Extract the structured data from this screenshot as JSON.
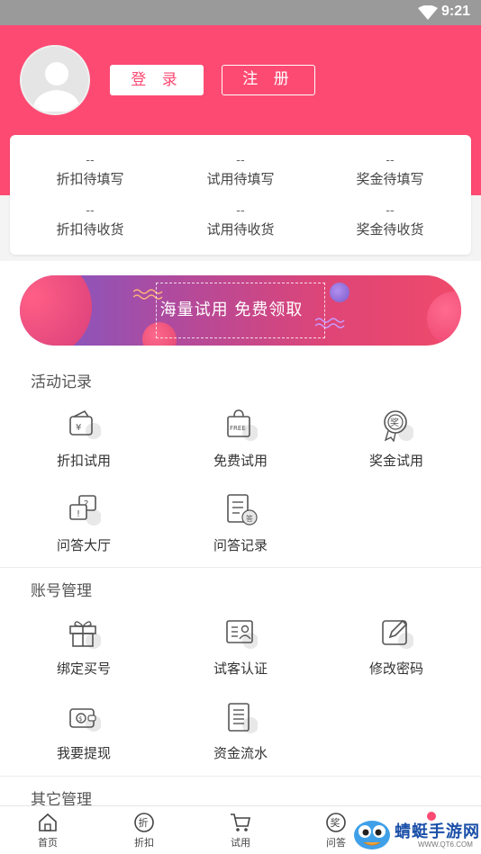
{
  "status_bar": {
    "time": "9:21"
  },
  "header": {
    "login_label": "登 录",
    "register_label": "注 册"
  },
  "stats": [
    {
      "value": "--",
      "label": "折扣待填写"
    },
    {
      "value": "--",
      "label": "试用待填写"
    },
    {
      "value": "--",
      "label": "奖金待填写"
    },
    {
      "value": "--",
      "label": "折扣待收货"
    },
    {
      "value": "--",
      "label": "试用待收货"
    },
    {
      "value": "--",
      "label": "奖金待收货"
    }
  ],
  "banner": {
    "text": "海量试用  免费领取"
  },
  "sections": {
    "activity": {
      "title": "活动记录",
      "items": [
        {
          "label": "折扣试用",
          "icon": "discount-wallet-icon"
        },
        {
          "label": "免费试用",
          "icon": "free-bag-icon"
        },
        {
          "label": "奖金试用",
          "icon": "prize-badge-icon"
        },
        {
          "label": "问答大厅",
          "icon": "qa-hall-icon"
        },
        {
          "label": "问答记录",
          "icon": "qa-record-icon"
        }
      ]
    },
    "account": {
      "title": "账号管理",
      "items": [
        {
          "label": "绑定买号",
          "icon": "gift-icon"
        },
        {
          "label": "试客认证",
          "icon": "id-card-icon"
        },
        {
          "label": "修改密码",
          "icon": "edit-icon"
        },
        {
          "label": "我要提现",
          "icon": "wallet-icon"
        },
        {
          "label": "资金流水",
          "icon": "ledger-icon"
        }
      ]
    },
    "other": {
      "title": "其它管理"
    }
  },
  "tab_bar": {
    "tabs": [
      {
        "label": "首页",
        "icon": "home-icon"
      },
      {
        "label": "折扣",
        "icon": "discount-tab-icon"
      },
      {
        "label": "试用",
        "icon": "cart-icon"
      },
      {
        "label": "问答",
        "icon": "prize-tab-icon"
      }
    ]
  },
  "watermark": {
    "name": "蜻蜓手游网",
    "url": "WWW.QT6.COM"
  },
  "colors": {
    "primary": "#fd4a72",
    "status_bar": "#9a9a9a",
    "icon_gray": "#555555"
  }
}
